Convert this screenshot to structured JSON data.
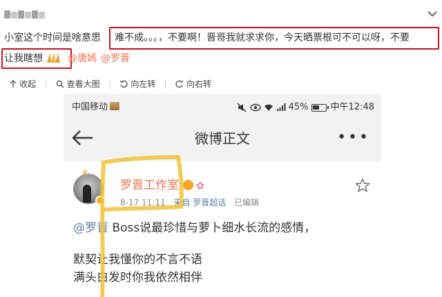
{
  "comment": {
    "line1_left": "小室这个时间是啥意思",
    "line1_right": "难不成。。。，不要啊！晋哥我就求求你，今天晒票根可不可以呀，不要",
    "line2_text": "让我瞎想",
    "mention_1": "@唐嫣",
    "mention_2": "@罗晋"
  },
  "toolbar": {
    "collapse": "收起",
    "view_large": "查看大图",
    "rotate_left": "向左转",
    "rotate_right": "向右转"
  },
  "phone": {
    "carrier": "中国移动",
    "battery": "45%",
    "time": "中午12:48",
    "nav_title": "微博正文",
    "more": "•••",
    "post": {
      "name": "罗晋工作室",
      "time": "8-17 11:11",
      "source": "来自 罗晋超话",
      "edited": "已编辑",
      "body_line1_mention": "@罗晋",
      "body_line1_text": " Boss说最珍惜与萝卜细水长流的感情，",
      "body_line2": "默契让我懂你的不言不语",
      "body_line3": "满头白发时你我依然相伴"
    }
  },
  "colors": {
    "highlight_box": "#c1121f",
    "mention": "#eb7350",
    "annotation": "#f0c33c"
  }
}
